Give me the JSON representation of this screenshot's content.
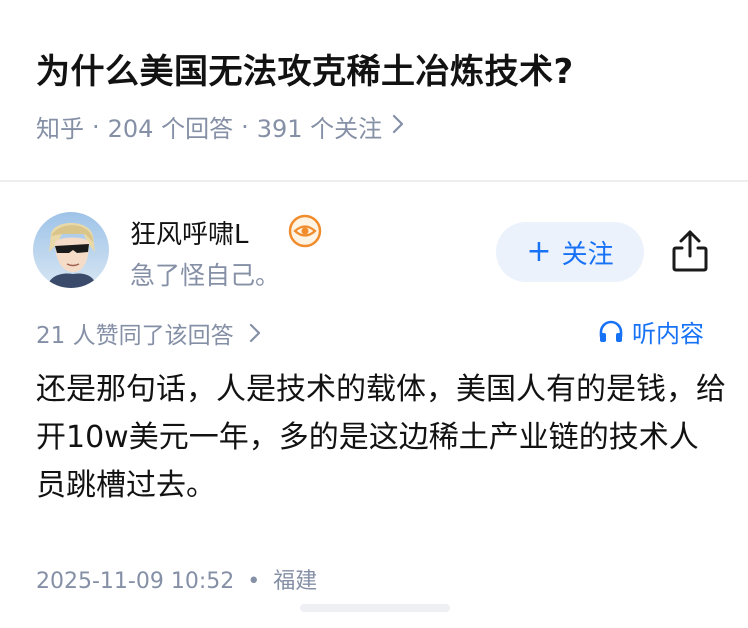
{
  "question": {
    "title": "为什么美国无法攻克稀土冶炼技术?",
    "source": "知乎",
    "answer_count": "204 个回答",
    "follower_count": "391 个关注",
    "separator": "·"
  },
  "author": {
    "name": "狂风呼啸L",
    "bio": "急了怪自己。",
    "avatar_icon": "avatar-sunglasses",
    "badge_icon": "eye-badge-icon"
  },
  "actions": {
    "follow_label": "关注",
    "listen_label": "听内容",
    "share_icon": "share-icon"
  },
  "answer": {
    "likes_text": "21 人赞同了该回答",
    "content": "还是那句话，人是技术的载体，美国人有的是钱，给开10w美元一年，多的是这边稀土产业链的技术人员跳槽过去。",
    "timestamp": "2025-11-09 10:52",
    "location": "福建"
  },
  "colors": {
    "accent": "#1772f6",
    "meta_gray": "#8590a6",
    "follow_bg": "#ebf2fc",
    "badge_orange": "#f08c2b"
  }
}
